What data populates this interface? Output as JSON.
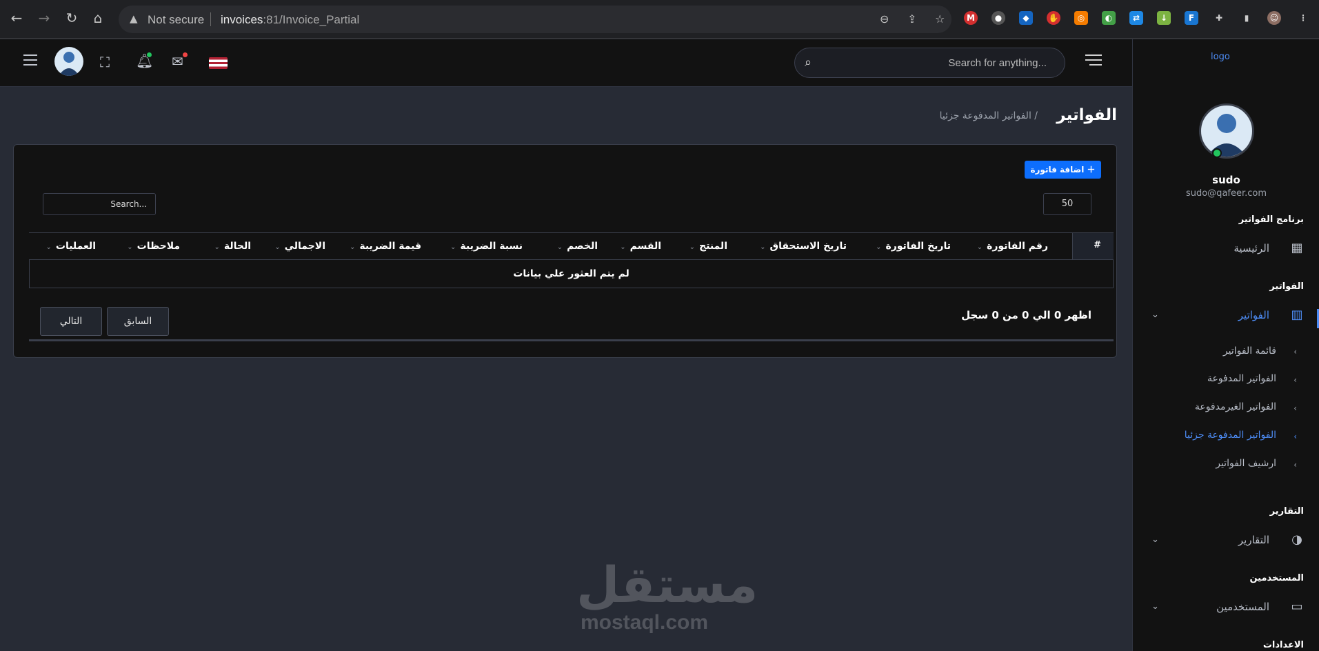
{
  "browser": {
    "security_label": "Not secure",
    "url_host": "invoices",
    "url_rest": ":81/Invoice_Partial"
  },
  "topbar": {
    "search_placeholder": "Search for anything..."
  },
  "sidebar": {
    "logo": "logo",
    "user_name": "sudo",
    "user_email": "sudo@qafeer.com",
    "section_program": "برنامج الفواتير",
    "home": "الرئيسية",
    "section_invoices": "الفواتير",
    "invoices": "الفواتير",
    "sub_items": [
      "قائمة الفواتير",
      "الفواتير المدفوعة",
      "الفواتير الغيرمدفوعة",
      "الفواتير المدفوعة جزئيا",
      "ارشيف الفواتير"
    ],
    "section_reports": "التقارير",
    "reports": "التقارير",
    "section_users": "المستخدمين",
    "users": "المستخدمين",
    "section_settings": "الاعدادات"
  },
  "main": {
    "page_title": "الفواتير",
    "breadcrumb": "/ الفواتير المدفوعة جزئيا",
    "add_invoice": "اضافة فاتورة",
    "page_length": "50",
    "table_search_placeholder": "Search...",
    "columns": [
      "#",
      "رقم الفاتورة",
      "تاريخ الفاتورة",
      "تاريخ الاستحقاق",
      "المنتج",
      "القسم",
      "الخصم",
      "نسبة الضريبة",
      "قيمة الضريبة",
      "الاجمالي",
      "الحالة",
      "ملاحظات",
      "العمليات"
    ],
    "empty_text": "لم يتم العثور علي بيانات",
    "info_text": "اظهر 0 الي 0 من 0 سجل",
    "prev": "السابق",
    "next": "التالي"
  },
  "watermark": {
    "arabic": "مستقل",
    "latin": "mostaql.com"
  },
  "colors": {
    "accent": "#0d6efd",
    "link": "#4d8cf5",
    "online": "#22c55e"
  }
}
